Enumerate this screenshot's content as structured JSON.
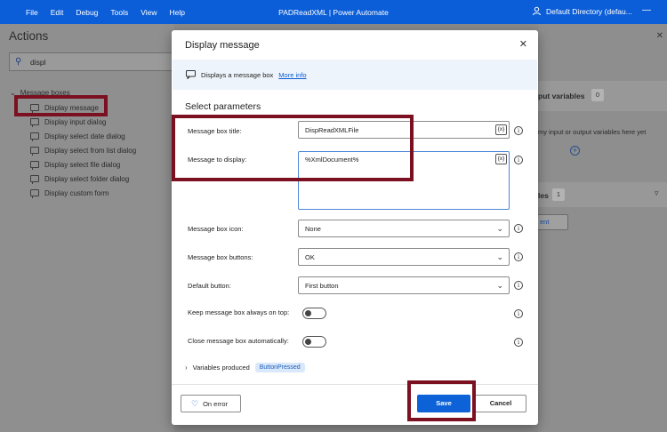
{
  "menu": [
    "File",
    "Edit",
    "Debug",
    "Tools",
    "View",
    "Help"
  ],
  "app_title": "PADReadXML | Power Automate",
  "directory": "Default Directory (defau...",
  "actions": {
    "title": "Actions",
    "search_value": "displ",
    "group": "Message boxes",
    "items": [
      "Display message",
      "Display input dialog",
      "Display select date dialog",
      "Display select from list dialog",
      "Display select file dialog",
      "Display select folder dialog",
      "Display custom form"
    ]
  },
  "right_panel": {
    "out_vars": "put variables",
    "out_count": "0",
    "hint": "my input or output variables here yet",
    "flow_vars": "les",
    "flow_count": "1",
    "chip": "ent"
  },
  "dialog": {
    "title": "Display message",
    "info_text": "Displays a message box",
    "info_link": "More info",
    "section": "Select parameters",
    "title_label": "Message box title:",
    "title_value": "DispReadXMLFile",
    "message_label": "Message to display:",
    "message_value": "%XmlDocument%",
    "icon_label": "Message box icon:",
    "icon_value": "None",
    "buttons_label": "Message box buttons:",
    "buttons_value": "OK",
    "default_label": "Default button:",
    "default_value": "First button",
    "ontop_label": "Keep message box always on top:",
    "autoclose_label": "Close message box automatically:",
    "vars_produced": "Variables produced",
    "vars_pill": "ButtonPressed",
    "var_symbol": "{x}",
    "on_error": "On error",
    "save": "Save",
    "cancel": "Cancel"
  },
  "colors": {
    "titlebar": "#0c5ed8",
    "primary_button": "#0d62d8",
    "highlight": "#7b1020"
  }
}
